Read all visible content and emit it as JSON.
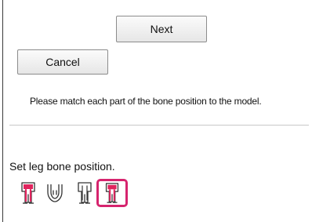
{
  "dialog": {
    "next_label": "Next",
    "cancel_label": "Cancel",
    "instruction": "Please match each part of the bone position to the model."
  },
  "leg_bone": {
    "label": "Set leg bone position.",
    "poses": [
      {
        "icon": "leg-pose-standing-icon",
        "selected": false
      },
      {
        "icon": "leg-pose-crouch-icon",
        "selected": false
      },
      {
        "icon": "leg-pose-outline-icon",
        "selected": false
      },
      {
        "icon": "leg-pose-standing-alt-icon",
        "selected": true
      }
    ]
  },
  "colors": {
    "selection_border": "#d6246e",
    "bone_highlight": "#e0245e"
  }
}
